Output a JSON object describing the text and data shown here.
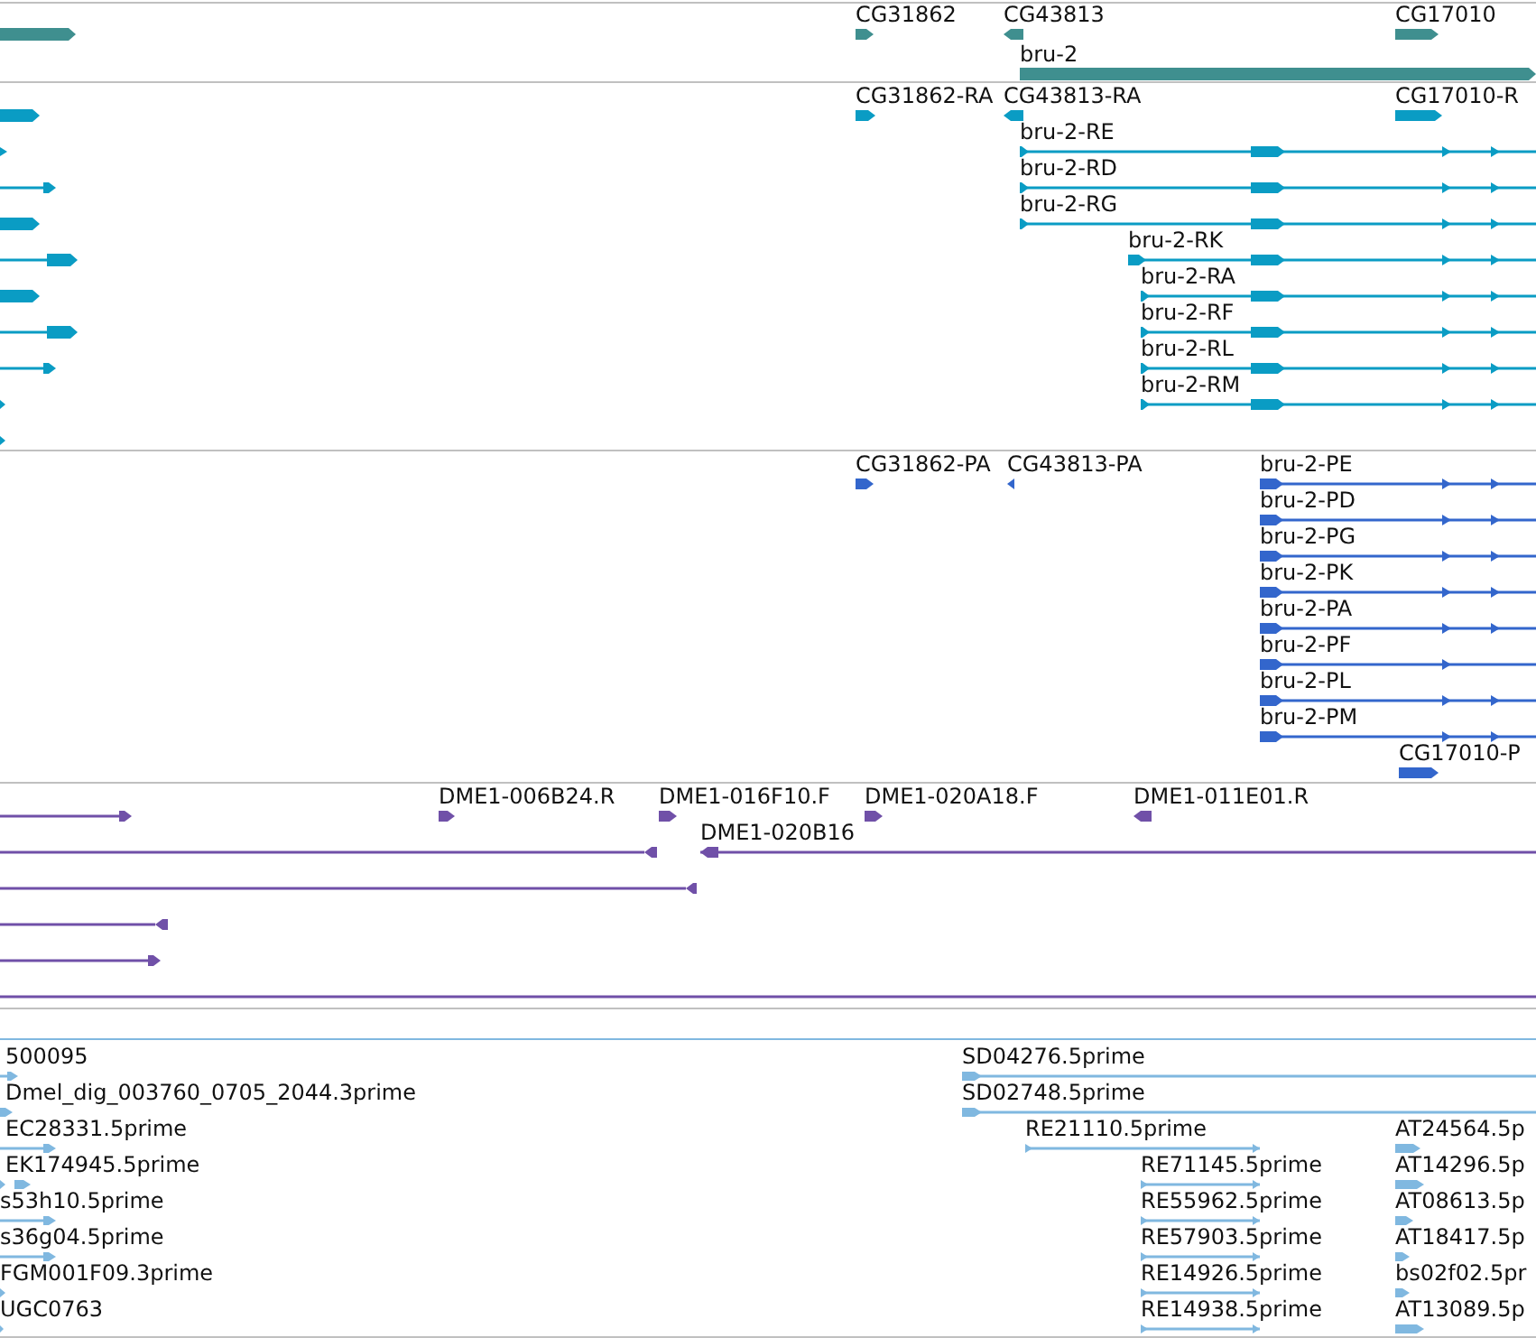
{
  "tracks": [
    {
      "kind": "gene",
      "color": "#3f8f8f",
      "features": [
        {
          "reverse": false
        },
        {
          "label": "CG31862",
          "reverse": false
        },
        {
          "label": "CG43813",
          "reverse": true
        },
        {
          "label": "CG17010",
          "reverse": false
        },
        {
          "label": "bru-2",
          "reverse": false
        }
      ]
    },
    {
      "kind": "transcript",
      "color": "#0a9cc4",
      "features": [
        {
          "reverse": false
        },
        {
          "reverse": false
        },
        {
          "reverse": false
        },
        {
          "reverse": false
        },
        {
          "reverse": false
        },
        {
          "reverse": false
        },
        {
          "reverse": false
        },
        {
          "reverse": false
        },
        {
          "reverse": false
        },
        {
          "reverse": false
        },
        {
          "label": "CG31862-RA",
          "reverse": false
        },
        {
          "label": "CG43813-RA",
          "reverse": true
        },
        {
          "label": "CG17010-R",
          "reverse": false
        },
        {
          "label": "bru-2-RE",
          "reverse": false
        },
        {
          "label": "bru-2-RD",
          "reverse": false
        },
        {
          "label": "bru-2-RG",
          "reverse": false
        },
        {
          "label": "bru-2-RK",
          "reverse": false
        },
        {
          "label": "bru-2-RA",
          "reverse": false
        },
        {
          "label": "bru-2-RF",
          "reverse": false
        },
        {
          "label": "bru-2-RL",
          "reverse": false
        },
        {
          "label": "bru-2-RM",
          "reverse": false
        }
      ]
    },
    {
      "kind": "protein",
      "color": "#3366cc",
      "features": [
        {
          "label": "CG31862-PA",
          "reverse": false
        },
        {
          "label": "CG43813-PA",
          "reverse": true
        },
        {
          "label": "bru-2-PE",
          "reverse": false
        },
        {
          "label": "bru-2-PD",
          "reverse": false
        },
        {
          "label": "bru-2-PG",
          "reverse": false
        },
        {
          "label": "bru-2-PK",
          "reverse": false
        },
        {
          "label": "bru-2-PA",
          "reverse": false
        },
        {
          "label": "bru-2-PF",
          "reverse": false
        },
        {
          "label": "bru-2-PL",
          "reverse": false
        },
        {
          "label": "bru-2-PM",
          "reverse": false
        },
        {
          "label": "CG17010-P",
          "reverse": false
        }
      ]
    },
    {
      "kind": "clone",
      "color": "#7050a8",
      "features": [
        {
          "kind": "arrow",
          "reverse": false
        },
        {
          "kind": "arrow",
          "label": "DME1-006B24.R",
          "reverse": false
        },
        {
          "kind": "arrow",
          "label": "DME1-016F10.F",
          "reverse": false
        },
        {
          "kind": "arrow",
          "label": "DME1-020A18.F",
          "reverse": false
        },
        {
          "kind": "arrow",
          "label": "DME1-011E01.R",
          "reverse": true
        },
        {
          "kind": "arrow",
          "reverse": true
        },
        {
          "kind": "arrow",
          "label": "DME1-020B16",
          "reverse": true
        },
        {
          "kind": "arrow",
          "reverse": true
        },
        {
          "kind": "arrow",
          "reverse": true
        },
        {
          "kind": "arrow",
          "reverse": false
        },
        {
          "kind": "line"
        }
      ]
    },
    {
      "kind": "est",
      "color": "#80b8e0",
      "features": [
        {
          "label": "500095",
          "reverse": false
        },
        {
          "label": "Dmel_dig_003760_0705_2044.3prime",
          "reverse": false
        },
        {
          "label": "EC28331.5prime",
          "reverse": false
        },
        {
          "label": "EK174945.5prime",
          "reverse": false
        },
        {
          "label": "s53h10.5prime",
          "reverse": false
        },
        {
          "label": "s36g04.5prime",
          "reverse": false
        },
        {
          "label": "FGM001F09.3prime",
          "reverse": false
        },
        {
          "label": "UGC0763",
          "reverse": false
        },
        {
          "label": "SD04276.5prime",
          "reverse": false
        },
        {
          "label": "SD02748.5prime",
          "reverse": false
        },
        {
          "label": "RE21110.5prime",
          "reverse": false
        },
        {
          "label": "RE71145.5prime",
          "reverse": false
        },
        {
          "label": "RE55962.5prime",
          "reverse": false
        },
        {
          "label": "RE57903.5prime",
          "reverse": false
        },
        {
          "label": "RE14926.5prime",
          "reverse": false
        },
        {
          "label": "RE14938.5prime",
          "reverse": false
        },
        {
          "label": "AT24564.5p",
          "reverse": false
        },
        {
          "label": "AT14296.5p",
          "reverse": false
        },
        {
          "label": "AT08613.5p",
          "reverse": false
        },
        {
          "label": "AT18417.5p",
          "reverse": false
        },
        {
          "label": "bs02f02.5pr",
          "reverse": false
        },
        {
          "label": "AT13089.5p",
          "reverse": false
        }
      ]
    }
  ]
}
